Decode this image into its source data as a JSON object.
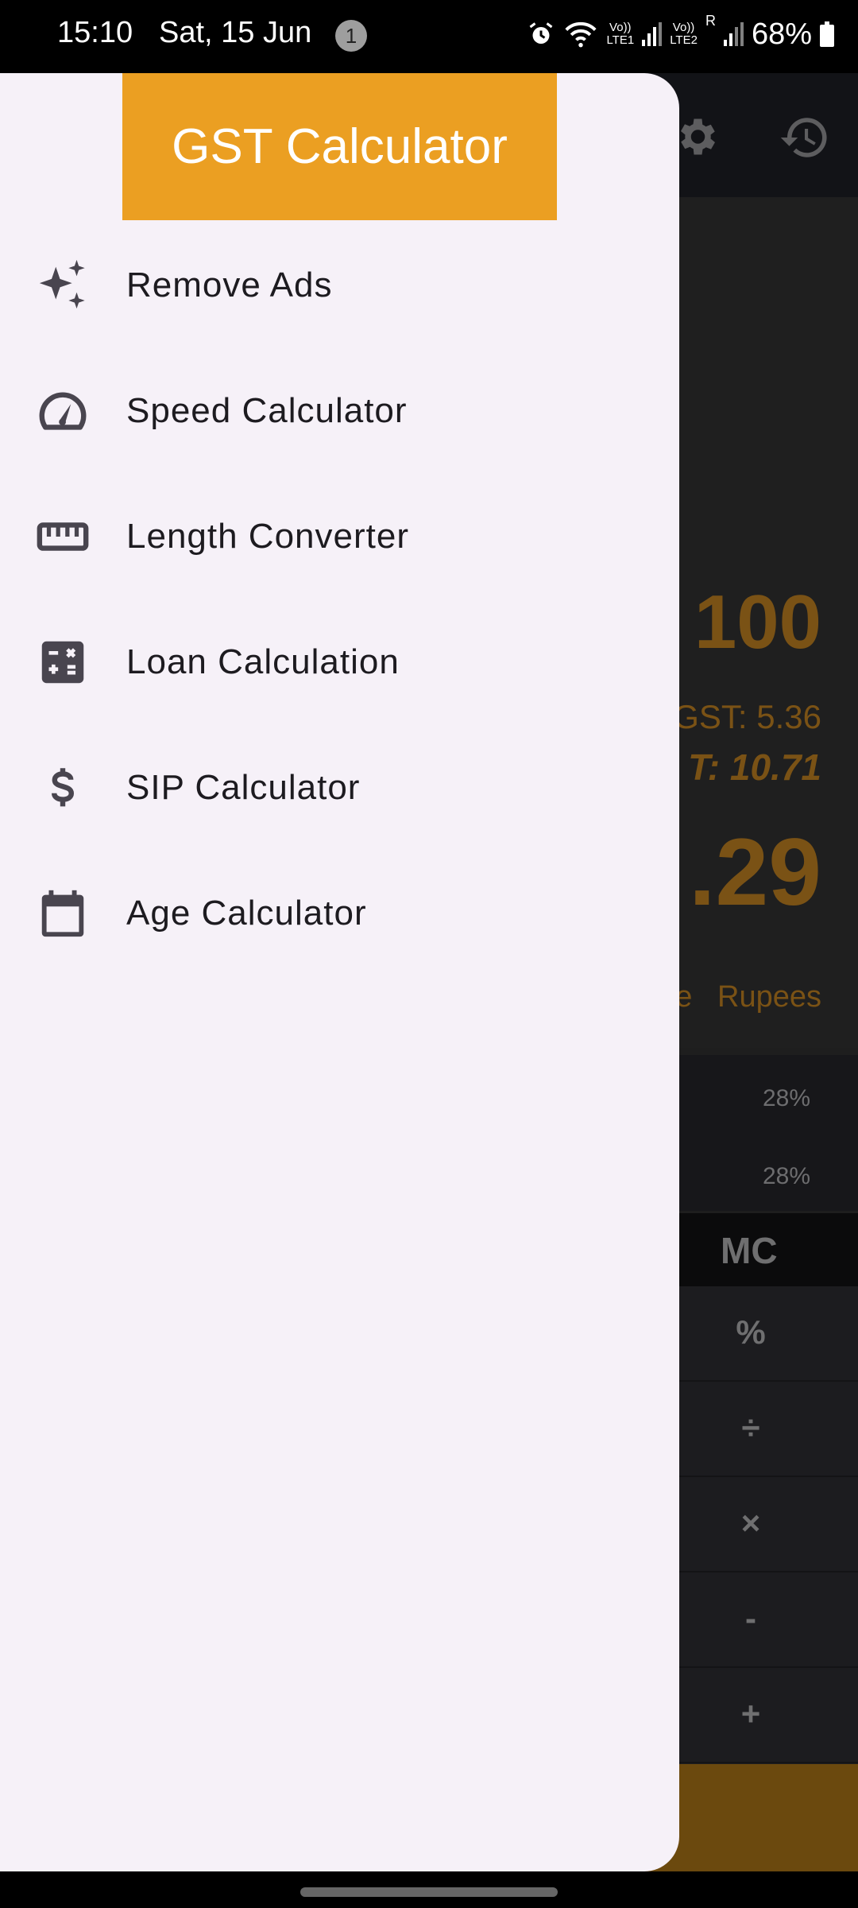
{
  "status_bar": {
    "time": "15:10",
    "date": "Sat, 15 Jun",
    "notification_count": "1",
    "sim1_label_top": "Vo))",
    "sim1_label_bottom": "LTE1",
    "sim2_label_top": "Vo))",
    "sim2_label_bottom": "LTE2",
    "roaming": "R",
    "battery": "68%",
    "icons": [
      "alarm-icon",
      "wifi-icon",
      "signal-icon",
      "signal-icon",
      "battery-icon"
    ]
  },
  "drawer": {
    "title": "GST Calculator",
    "header_color": "#eb9f22",
    "items": [
      {
        "label": "Remove Ads",
        "icon": "sparkles-icon"
      },
      {
        "label": "Speed Calculator",
        "icon": "speedometer-icon"
      },
      {
        "label": "Length Converter",
        "icon": "ruler-icon"
      },
      {
        "label": "Loan Calculation",
        "icon": "calculator-icon"
      },
      {
        "label": "SIP Calculator",
        "icon": "dollar-icon"
      },
      {
        "label": "Age Calculator",
        "icon": "calendar-icon"
      }
    ]
  },
  "background_app": {
    "toolbar_icons": [
      "gear-icon",
      "history-icon"
    ],
    "display": {
      "amount": "100",
      "cgst_partial": "GST: 5.36",
      "gst_partial": "T: 10.71",
      "total_partial": ".29",
      "units_partial": "e   Rupees"
    },
    "rates": [
      "28%",
      "28%"
    ],
    "memory_button": "MC",
    "operators": [
      "%",
      "÷",
      "×",
      "-",
      "+"
    ],
    "accent_color": "#6b490e"
  }
}
